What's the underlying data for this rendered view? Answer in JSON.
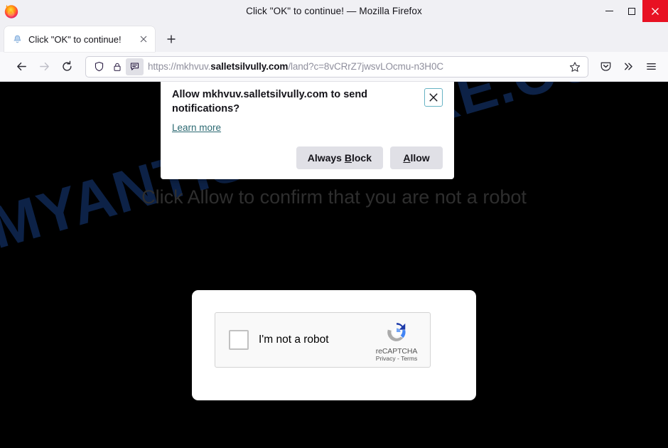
{
  "window": {
    "title": "Click \"OK\" to continue! — Mozilla Firefox",
    "minimize_label": "Minimize",
    "maximize_label": "Maximize",
    "close_label": "Close"
  },
  "tabs": [
    {
      "title": "Click \"OK\" to continue!",
      "favicon": "bell-icon",
      "close_label": "×"
    }
  ],
  "newtab": {
    "label": "+"
  },
  "nav": {
    "back": "←",
    "forward": "→",
    "reload": "⟳"
  },
  "urlbar": {
    "shield_icon": "shield-icon",
    "lock_icon": "lock-icon",
    "permission_icon": "notification-permission-icon",
    "scheme": "https://",
    "subdomain": "mkhvuv.",
    "domain": "salletsilvully.com",
    "path": "/land?c=8vCRrZ7jwsvLOcmu-n3H0C",
    "full_url": "https://mkhvuv.salletsilvully.com/land?c=8vCRrZ7jwsvLOcmu-n3H0C",
    "bookmark_icon": "star-icon"
  },
  "toolbar_right": {
    "pocket": "pocket-icon",
    "overflow": "»",
    "menu": "hamburger-menu-icon"
  },
  "page": {
    "background_color": "#000000",
    "heading": "Click Allow to confirm that you are not a robot",
    "watermark": "MYANTISPYWARE.COM",
    "watermark_color": "#0d2247",
    "captcha": {
      "checkbox_state": "unchecked",
      "label": "I'm not a robot",
      "brand": "reCAPTCHA",
      "terms": "Privacy - Terms"
    }
  },
  "permission_popup": {
    "title": "Allow mkhvuv.salletsilvully.com to send notifications?",
    "learn_more": "Learn more",
    "close_label": "×",
    "buttons": {
      "block": "Always Block",
      "block_prefix": "Always ",
      "block_accesskey": "B",
      "block_suffix": "lock",
      "allow": "Allow",
      "allow_accesskey": "A",
      "allow_suffix": "llow"
    }
  }
}
